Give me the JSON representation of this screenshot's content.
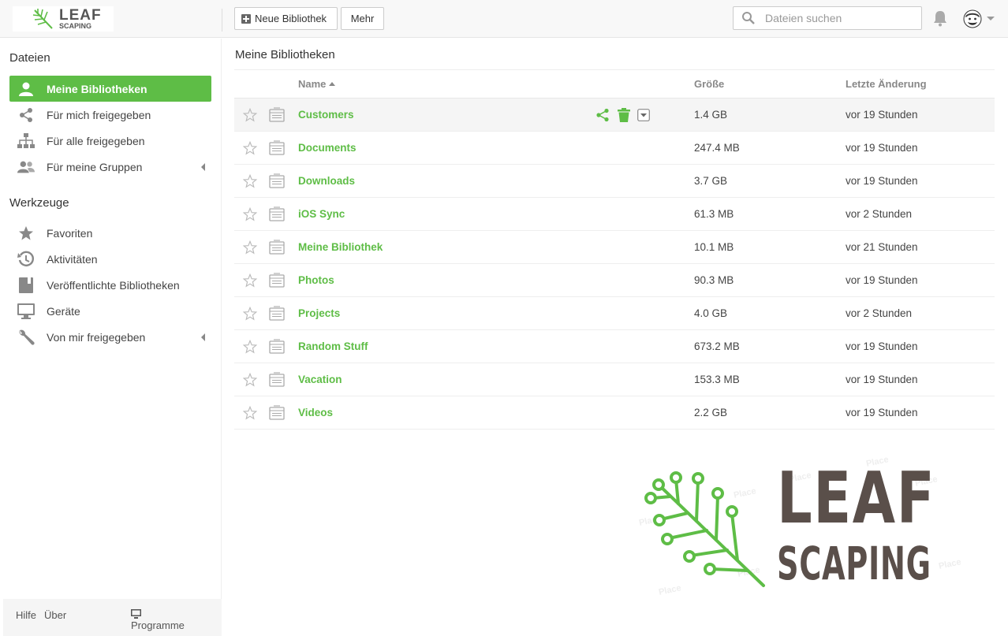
{
  "header": {
    "logo": {
      "line1": "LEAF",
      "line2": "SCAPING"
    },
    "new_library_label": "Neue Bibliothek",
    "more_label": "Mehr",
    "search_placeholder": "Dateien suchen"
  },
  "sidebar": {
    "files_heading": "Dateien",
    "files_items": [
      {
        "label": "Meine Bibliotheken",
        "icon": "user-icon",
        "active": true
      },
      {
        "label": "Für mich freigegeben",
        "icon": "share-icon"
      },
      {
        "label": "Für alle freigegeben",
        "icon": "org-icon"
      },
      {
        "label": "Für meine Gruppen",
        "icon": "group-icon",
        "expandable": true
      }
    ],
    "tools_heading": "Werkzeuge",
    "tools_items": [
      {
        "label": "Favoriten",
        "icon": "star-icon"
      },
      {
        "label": "Aktivitäten",
        "icon": "history-icon"
      },
      {
        "label": "Veröffentlichte Bibliotheken",
        "icon": "book-icon"
      },
      {
        "label": "Geräte",
        "icon": "monitor-icon"
      },
      {
        "label": "Von mir freigegeben",
        "icon": "wrench-icon",
        "expandable": true
      }
    ],
    "footer": {
      "help": "Hilfe",
      "about": "Über",
      "programs": "Programme"
    }
  },
  "main": {
    "title": "Meine Bibliotheken",
    "columns": {
      "name": "Name",
      "size": "Größe",
      "modified": "Letzte Änderung"
    },
    "rows": [
      {
        "name": "Customers",
        "size": "1.4 GB",
        "modified": "vor 19 Stunden"
      },
      {
        "name": "Documents",
        "size": "247.4 MB",
        "modified": "vor 19 Stunden"
      },
      {
        "name": "Downloads",
        "size": "3.7 GB",
        "modified": "vor 19 Stunden"
      },
      {
        "name": "iOS Sync",
        "size": "61.3 MB",
        "modified": "vor 2 Stunden"
      },
      {
        "name": "Meine Bibliothek",
        "size": "10.1 MB",
        "modified": "vor 21 Stunden"
      },
      {
        "name": "Photos",
        "size": "90.3 MB",
        "modified": "vor 19 Stunden"
      },
      {
        "name": "Projects",
        "size": "4.0 GB",
        "modified": "vor 2 Stunden"
      },
      {
        "name": "Random Stuff",
        "size": "673.2 MB",
        "modified": "vor 19 Stunden"
      },
      {
        "name": "Vacation",
        "size": "153.3 MB",
        "modified": "vor 19 Stunden"
      },
      {
        "name": "Videos",
        "size": "2.2 GB",
        "modified": "vor 19 Stunden"
      }
    ]
  },
  "branding": {
    "line1": "LEAF",
    "line2": "SCAPING",
    "watermark": "Place"
  },
  "colors": {
    "accent": "#5ebd46",
    "logo_text": "#5a4f4a"
  }
}
